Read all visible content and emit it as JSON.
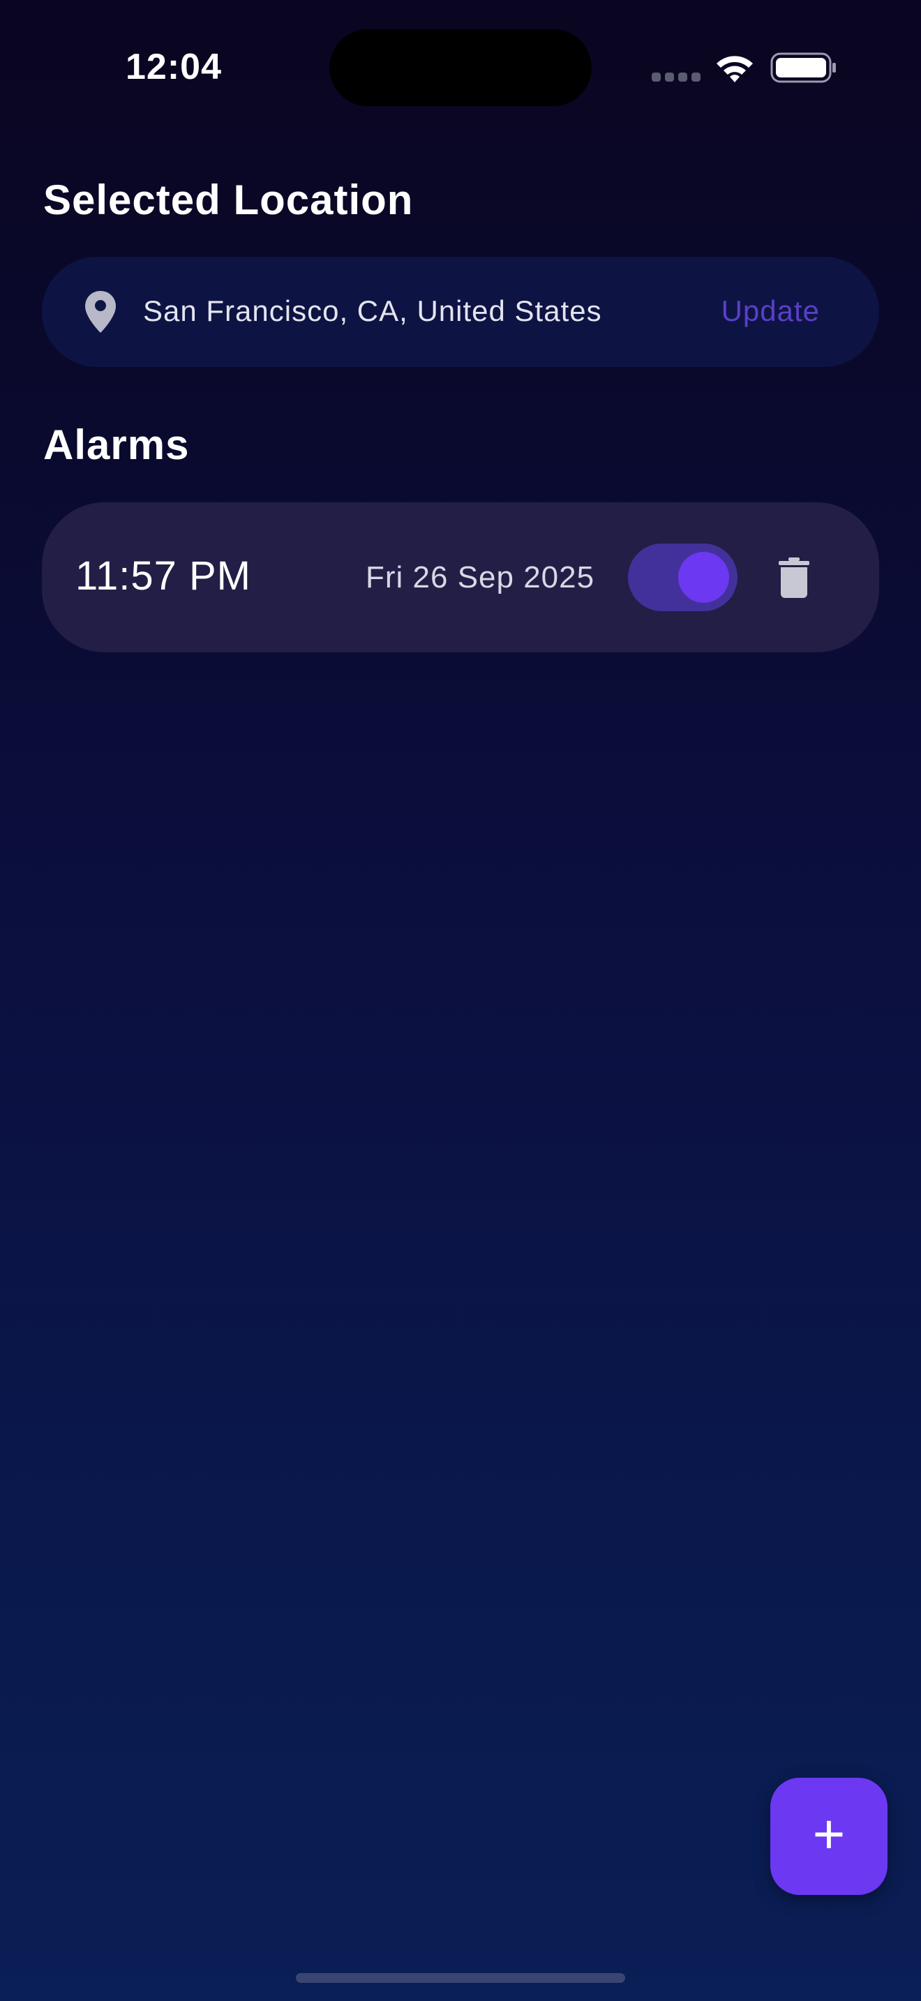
{
  "status_bar": {
    "time": "12:04",
    "wifi_icon": "wifi-icon",
    "battery_icon": "battery-icon"
  },
  "location": {
    "section_title": "Selected Location",
    "icon": "location-pin-icon",
    "value": "San Francisco, CA, United States",
    "update_label": "Update"
  },
  "alarms": {
    "section_title": "Alarms",
    "items": [
      {
        "time": "11:57 PM",
        "date": "Fri 26 Sep 2025",
        "enabled": true,
        "delete_icon": "trash-icon"
      }
    ]
  },
  "fab": {
    "label": "+",
    "icon": "plus-icon"
  },
  "colors": {
    "accent": "#6c38f2",
    "update_link": "#5a3fc7",
    "card": "#231e45"
  }
}
